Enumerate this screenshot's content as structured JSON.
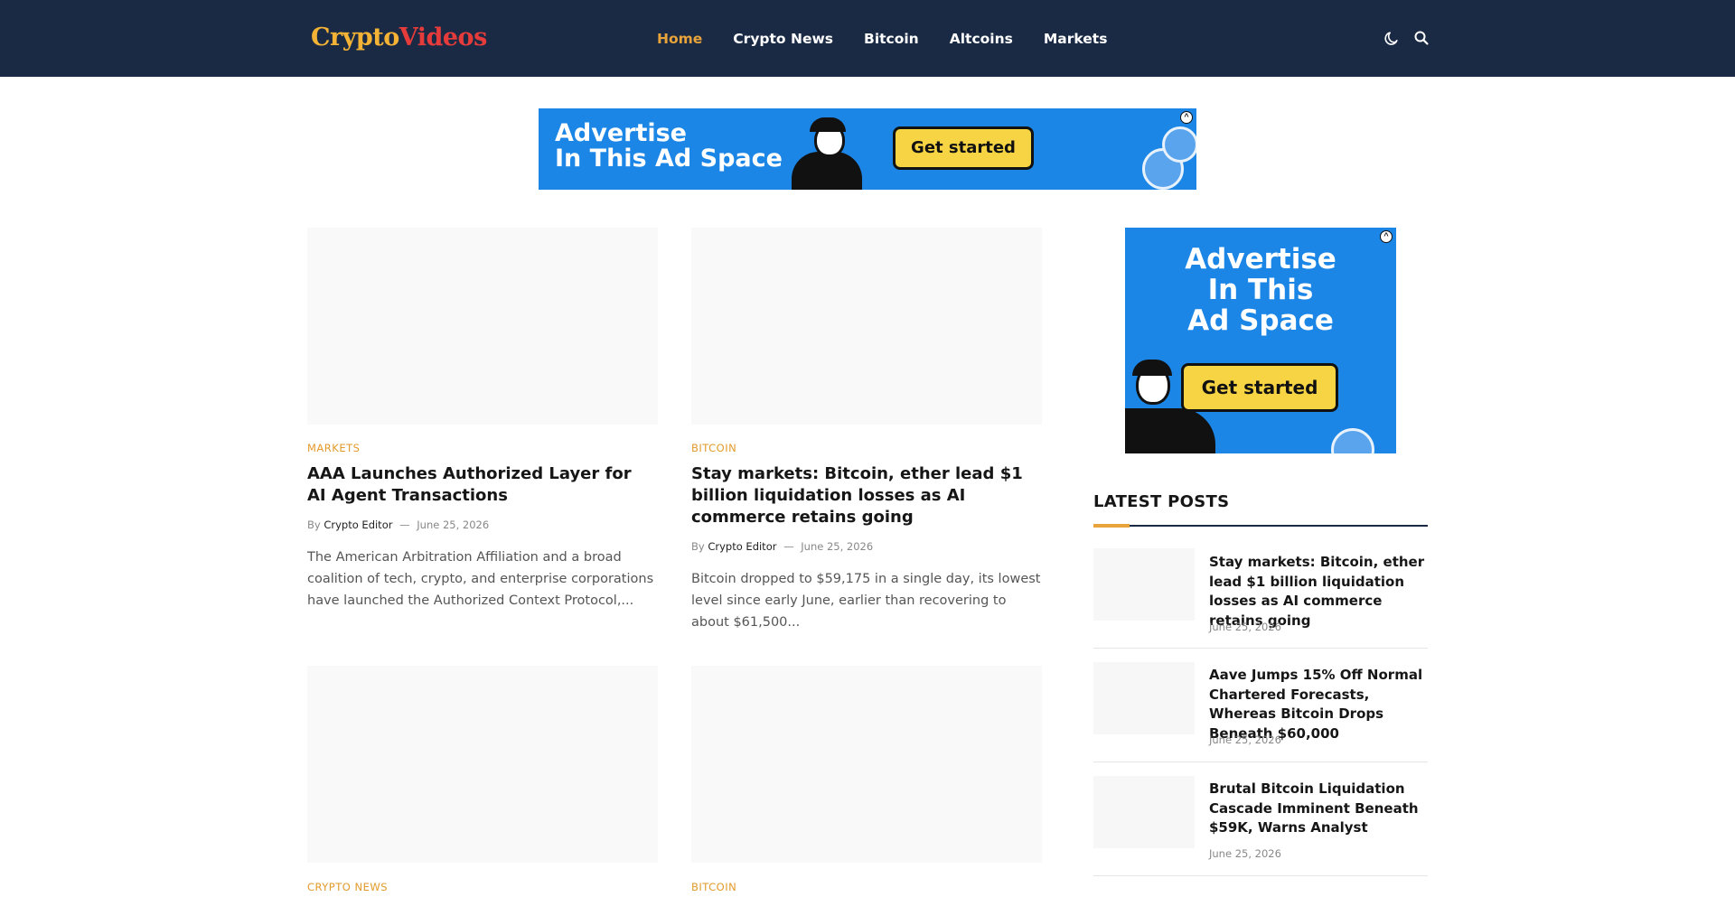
{
  "brand": {
    "logo_part1": "Crypto",
    "logo_part2": "Videos"
  },
  "nav": {
    "items": [
      {
        "label": "Home",
        "active": true
      },
      {
        "label": "Crypto News"
      },
      {
        "label": "Bitcoin"
      },
      {
        "label": "Altcoins"
      },
      {
        "label": "Markets"
      }
    ]
  },
  "header_icons": [
    "moon-icon",
    "search-icon"
  ],
  "ads": {
    "top": {
      "line1": "Advertise",
      "line2": "In This Ad Space",
      "cta": "Get started"
    },
    "side": {
      "line1": "Advertise",
      "line2": "In This",
      "line3": "Ad Space",
      "cta": "Get started"
    }
  },
  "articles": [
    {
      "category": "MARKETS",
      "title": "AAA Launches Authorized Layer for AI Agent Transactions",
      "by": "By",
      "author": "Crypto Editor",
      "sep": "—",
      "date": "June 25, 2026",
      "excerpt": "The American Arbitration Affiliation and a broad coalition of tech, crypto, and enterprise corporations have launched the Authorized Context Protocol,..."
    },
    {
      "category": "BITCOIN",
      "title": "Stay markets: Bitcoin, ether lead $1 billion liquidation losses as AI commerce retains going",
      "by": "By",
      "author": "Crypto Editor",
      "sep": "—",
      "date": "June 25, 2026",
      "excerpt": "Bitcoin dropped to $59,175 in a single day, its lowest level since early June, earlier than recovering to about $61,500..."
    },
    {
      "category": "CRYPTO NEWS"
    },
    {
      "category": "BITCOIN"
    }
  ],
  "sidebar": {
    "title": "LATEST POSTS",
    "posts": [
      {
        "title": "Stay markets: Bitcoin, ether lead $1 billion liquidation losses as AI commerce retains going",
        "date": "June 25, 2026"
      },
      {
        "title": "Aave Jumps 15% Off Normal Chartered Forecasts, Whereas Bitcoin Drops Beneath $60,000",
        "date": "June 25, 2026"
      },
      {
        "title": "Brutal Bitcoin Liquidation Cascade Imminent Beneath $59K, Warns Analyst",
        "date": "June 25, 2026"
      }
    ]
  },
  "colors": {
    "header_bg": "#1a2a44",
    "accent": "#e8a33a",
    "ad_blue": "#1b86e6",
    "ad_yellow": "#f6d443"
  }
}
